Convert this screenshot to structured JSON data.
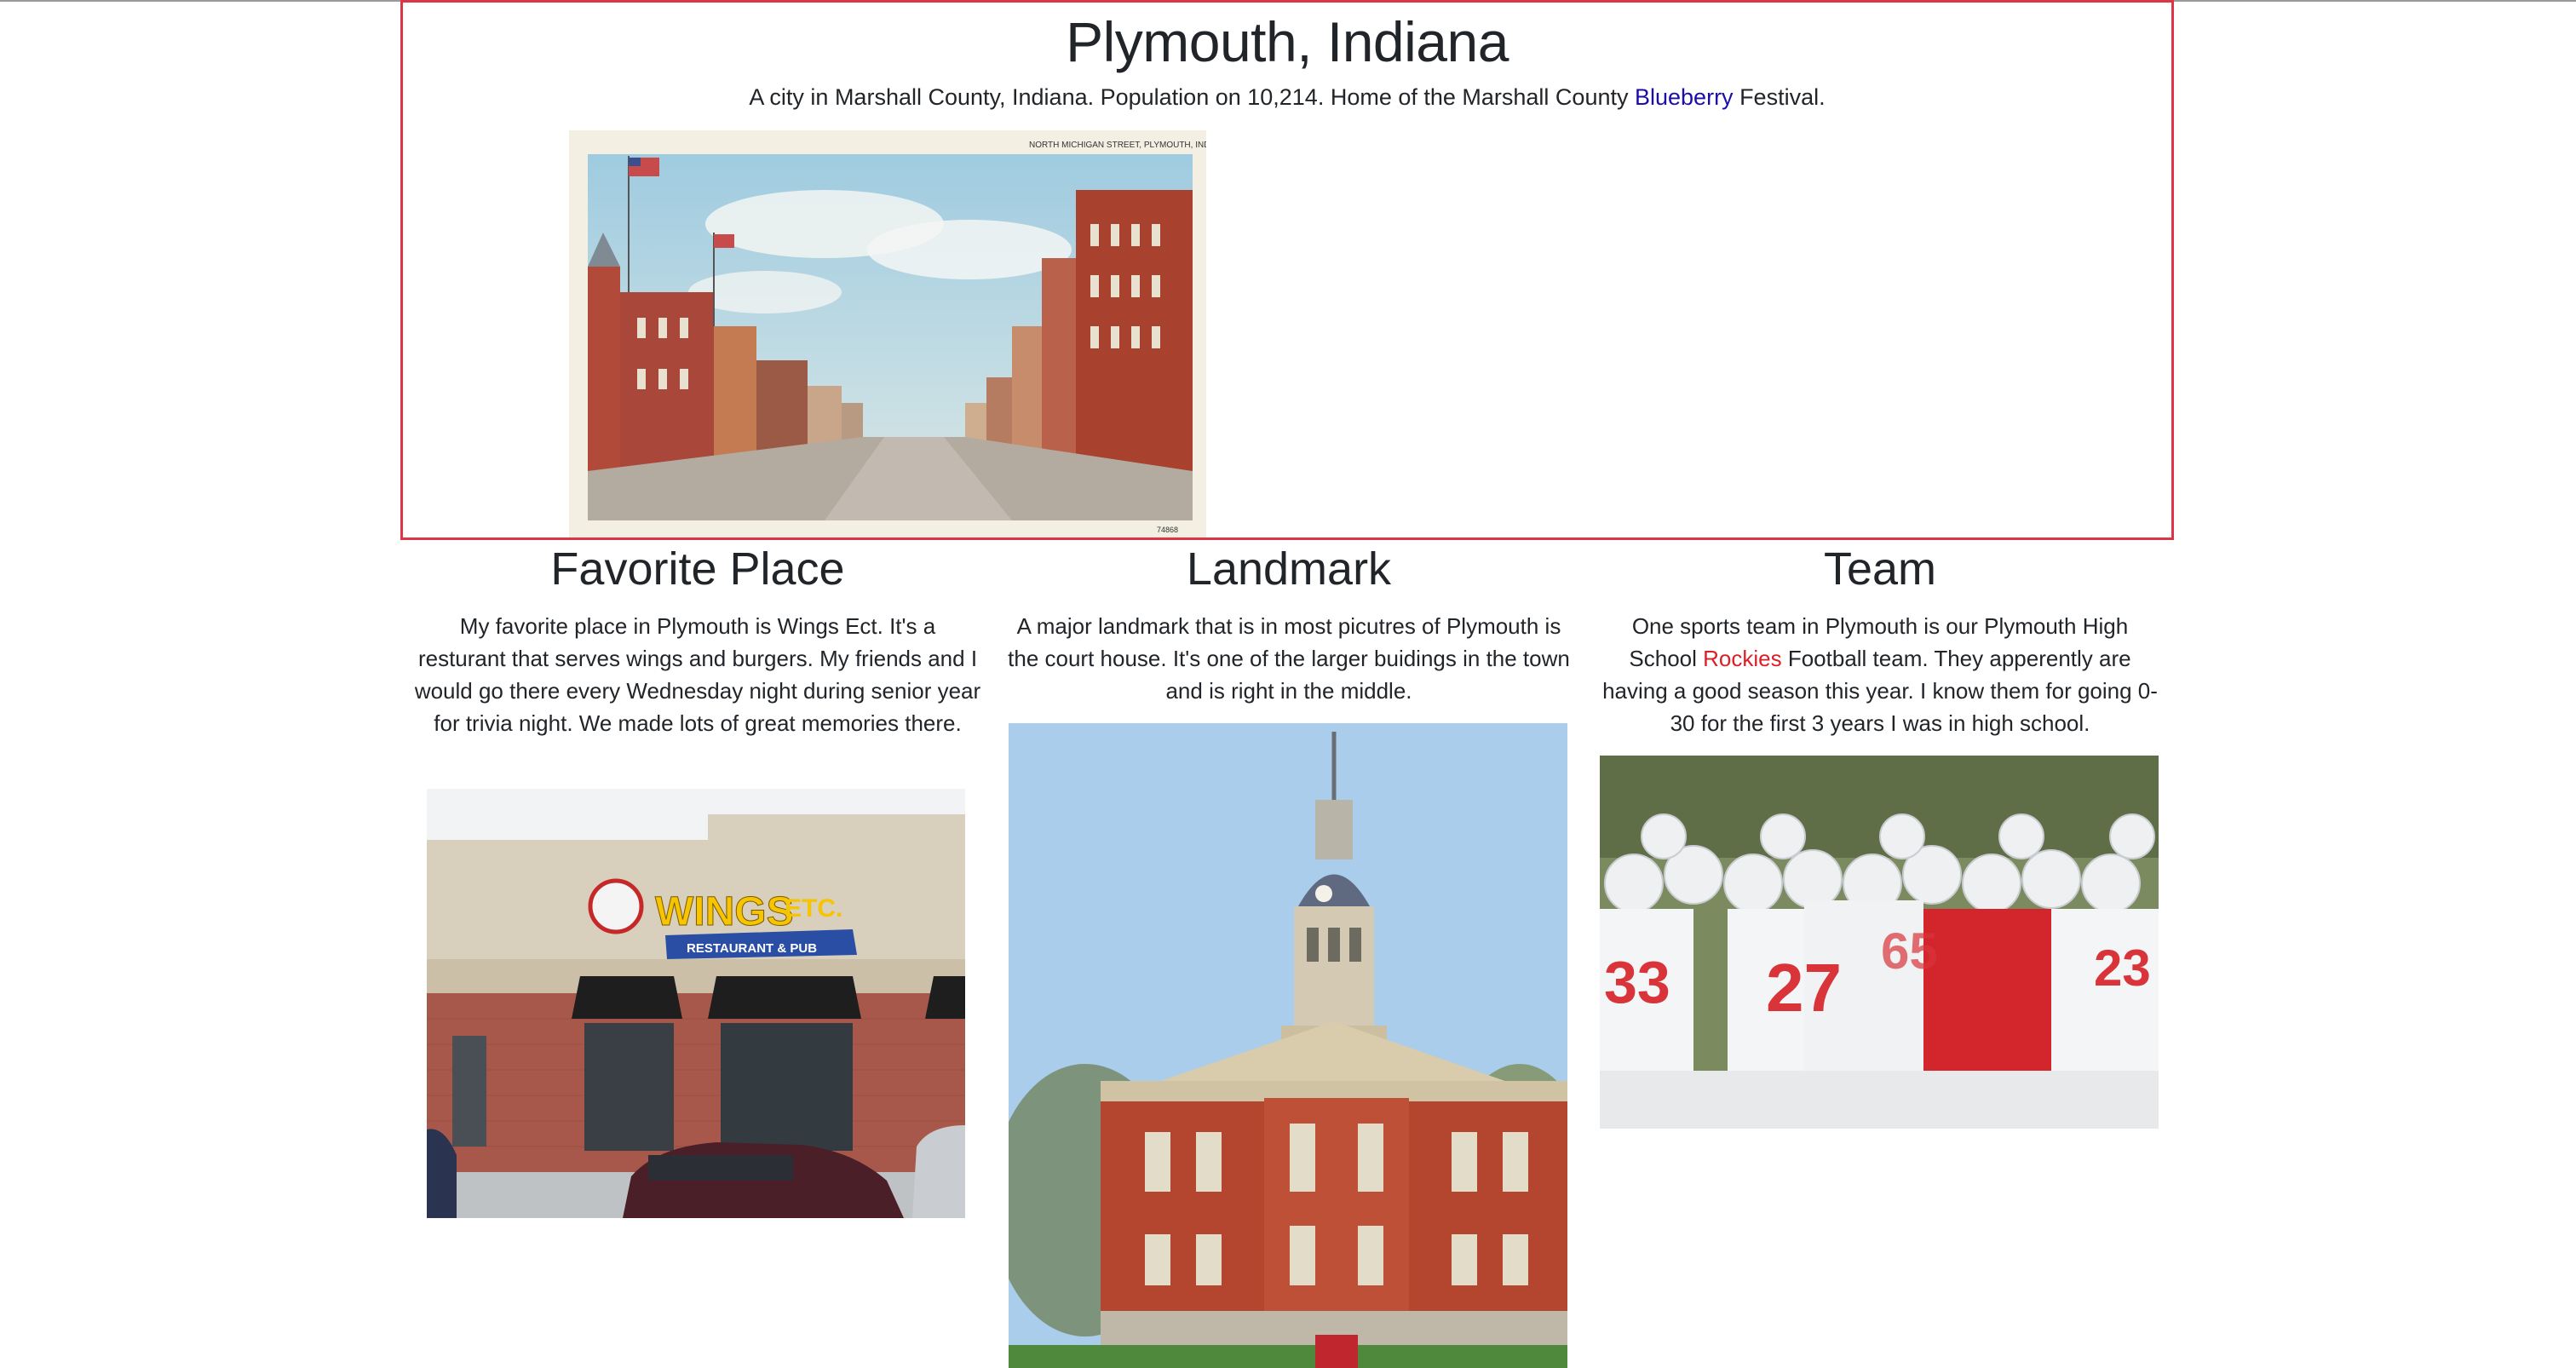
{
  "hero": {
    "title": "Plymouth, Indiana",
    "description_pre": "A city in Marshall County, Indiana. Population on 10,214. Home of the Marshall County ",
    "description_highlight": "Blueberry",
    "description_post": " Festival.",
    "postcard_caption": "NORTH MICHIGAN STREET, PLYMOUTH, IND."
  },
  "columns": {
    "favorite": {
      "title": "Favorite Place",
      "text": "My favorite place in Plymouth is Wings Ect. It's a resturant that serves wings and burgers. My friends and I would go there every Wednesday night during senior year for trivia night. We made lots of great memories there.",
      "sign_main": "WINGS",
      "sign_etc": "ETC.",
      "sign_sub": "RESTAURANT & PUB"
    },
    "landmark": {
      "title": "Landmark",
      "text": "A major landmark that is in most picutres of Plymouth is the court house. It's one of the larger buidings in the town and is right in the middle."
    },
    "team": {
      "title": "Team",
      "text_pre": "One sports team in Plymouth is our Plymouth High School ",
      "text_highlight": "Rockies",
      "text_post": " Football team. They apperently are having a good season this year. I know them for going 0-30 for the first 3 years I was in high school.",
      "jersey_numbers": [
        "33",
        "27",
        "65",
        "23"
      ]
    }
  },
  "colors": {
    "hero_border": "#dc3545",
    "link_blue": "#1a0dab",
    "highlight_red": "#dc1f26",
    "text": "#212529"
  }
}
